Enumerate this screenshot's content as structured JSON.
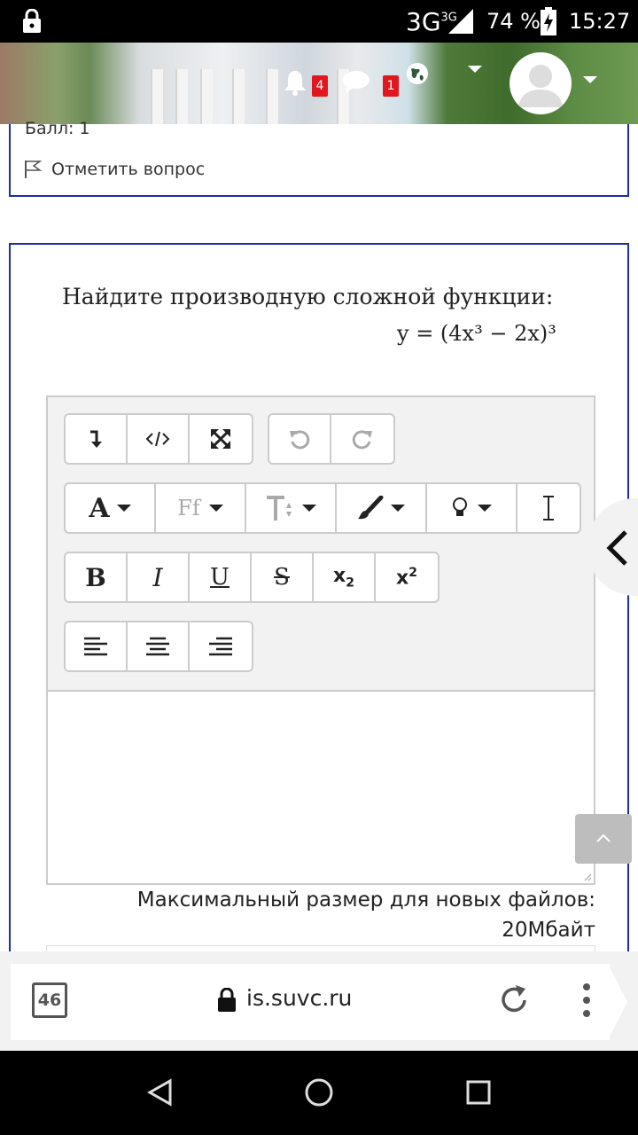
{
  "status_bar": {
    "network": "3G",
    "network_sup": "3G",
    "battery_percent": "74 %",
    "time": "15:27"
  },
  "header": {
    "notifications_count": "4",
    "messages_count": "1"
  },
  "question_prev": {
    "score": "Балл: 1",
    "flag_label": "Отметить вопрос"
  },
  "question": {
    "text": "Найдите производную сложной функции:",
    "formula": "y = (4x³ − 2x)³"
  },
  "editor": {
    "max_size_line1": "Максимальный размер для новых файлов:",
    "max_size_line2": "20Мбайт"
  },
  "browser": {
    "tab_count": "46",
    "url": "is.suvc.ru"
  },
  "colors": {
    "card_border": "#1e2ea0",
    "badge": "#e0171e"
  }
}
